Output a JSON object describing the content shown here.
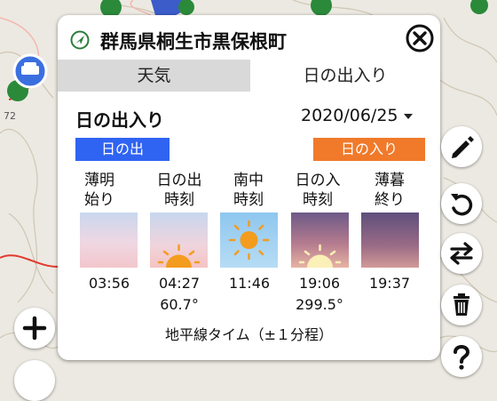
{
  "map": {
    "scale_text": "72"
  },
  "popup": {
    "title": "群馬県桐生市黒保根町",
    "tabs": [
      {
        "label": "天気",
        "selected": false
      },
      {
        "label": "日の出入り",
        "selected": true
      }
    ],
    "section_title": "日の出入り",
    "date": "2020/06/25",
    "badge_sunrise": "日の出",
    "badge_sunset": "日の入り",
    "columns": [
      {
        "label_line1": "薄明",
        "label_line2": "始り",
        "time": "03:56",
        "angle": ""
      },
      {
        "label_line1": "日の出",
        "label_line2": "時刻",
        "time": "04:27",
        "angle": "60.7°"
      },
      {
        "label_line1": "南中",
        "label_line2": "時刻",
        "time": "11:46",
        "angle": ""
      },
      {
        "label_line1": "日の入",
        "label_line2": "時刻",
        "time": "19:06",
        "angle": "299.5°"
      },
      {
        "label_line1": "薄暮",
        "label_line2": "終り",
        "time": "19:37",
        "angle": ""
      }
    ],
    "footer": "地平線タイム（±１分程）"
  },
  "colors": {
    "sunrise_badge": "#2f63f2",
    "sunset_badge": "#f07a2a",
    "tab_inactive": "#d9d9d9",
    "sun": "#f39c1e"
  },
  "icons": [
    "navigation-arrow-icon",
    "close-icon",
    "pencil-icon",
    "undo-icon",
    "swap-icon",
    "trash-icon",
    "help-icon",
    "zoom-in-icon"
  ]
}
